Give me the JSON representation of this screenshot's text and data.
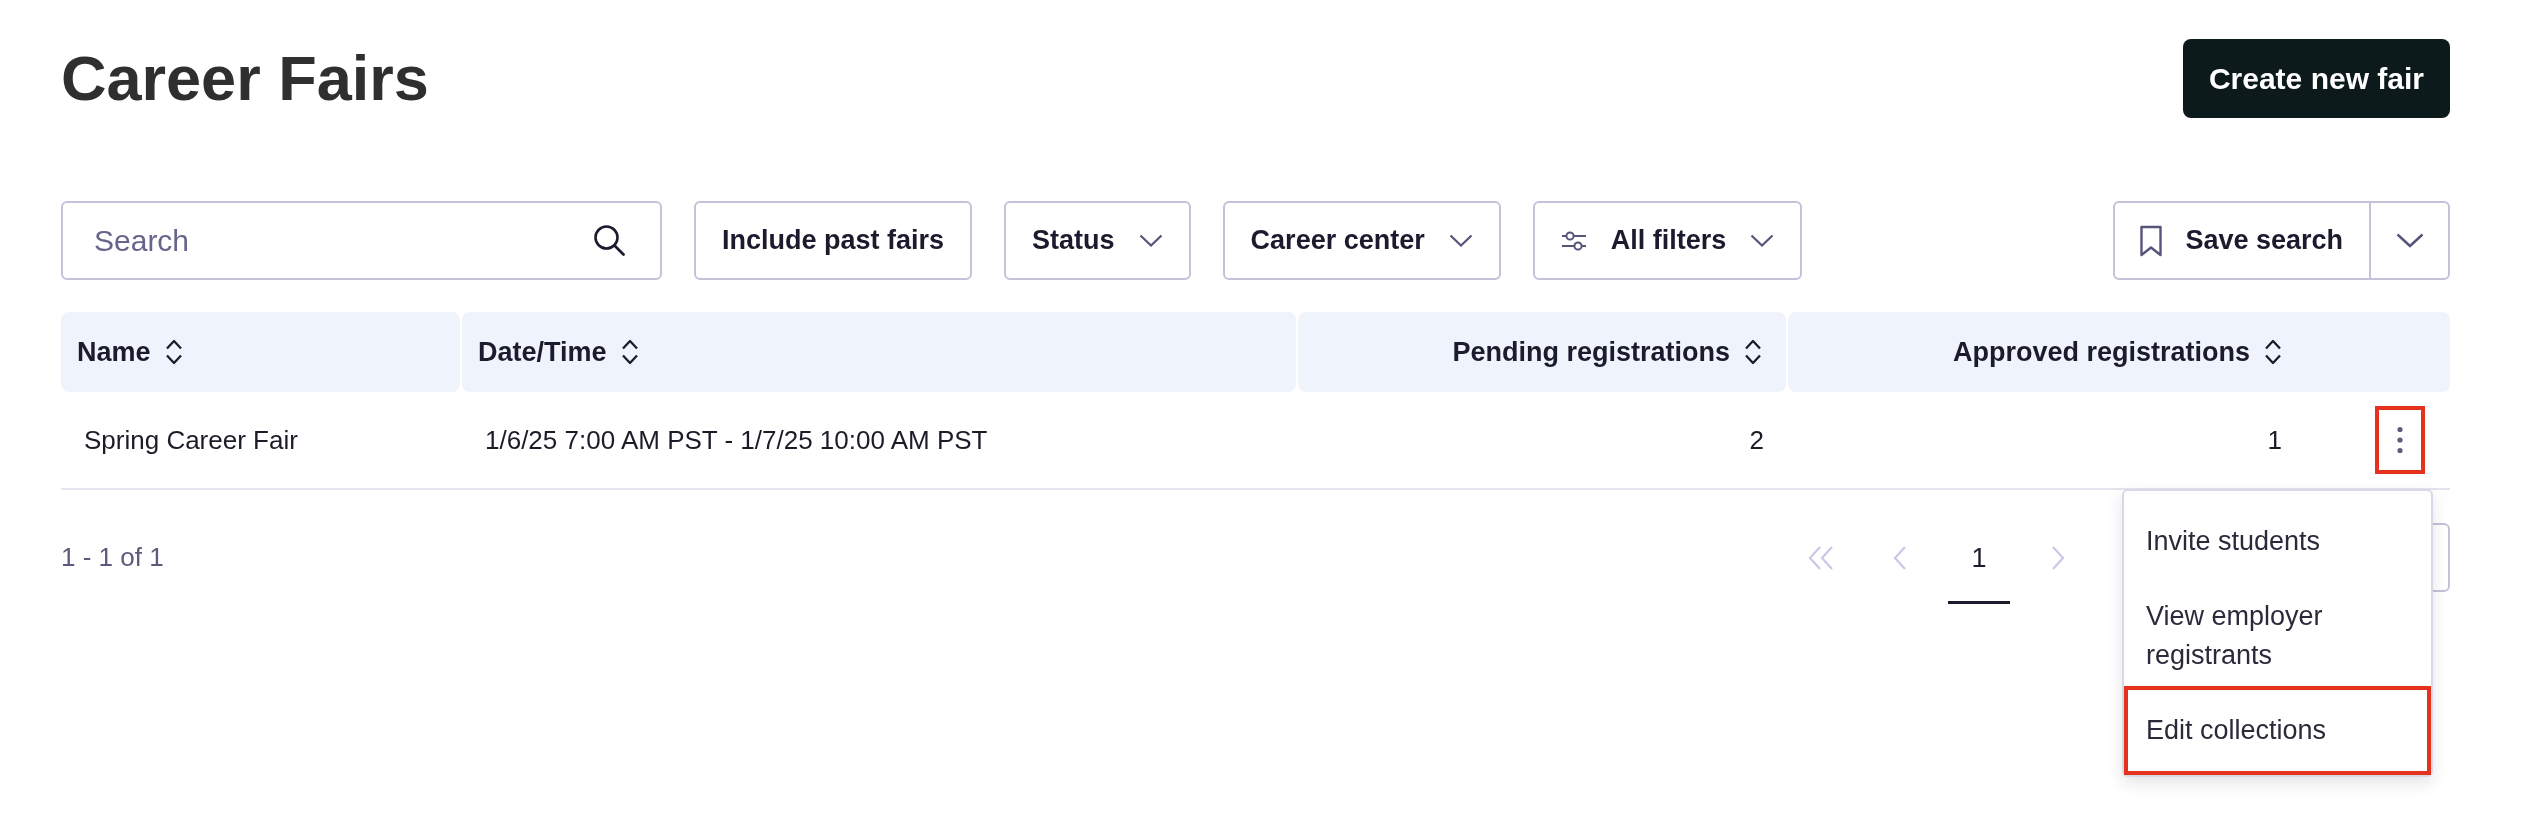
{
  "header": {
    "title": "Career Fairs",
    "create_button": "Create new fair"
  },
  "filters": {
    "search": {
      "placeholder": "Search"
    },
    "buttons": [
      {
        "kind": "toggle",
        "label": "Include past fairs"
      },
      {
        "kind": "dropdown",
        "label": "Status"
      },
      {
        "kind": "dropdown",
        "label": "Career center"
      },
      {
        "kind": "filters",
        "label": "All filters"
      }
    ],
    "save_search": "Save search"
  },
  "table": {
    "columns": [
      {
        "label": "Name",
        "kind": "text"
      },
      {
        "label": "Date/Time",
        "kind": "text"
      },
      {
        "label": "Pending registrations",
        "kind": "number"
      },
      {
        "label": "Approved registrations",
        "kind": "number"
      }
    ],
    "rows": [
      {
        "cells": [
          "Spring Career Fair",
          "1/6/25 7:00 AM PST - 1/7/25 10:00 AM PST",
          "2",
          "1"
        ],
        "more_button": {
          "highlighted": true
        }
      }
    ]
  },
  "row_menu": {
    "items": [
      {
        "label": "Invite students",
        "highlighted": false
      },
      {
        "label": "View employer registrants",
        "highlighted": false
      },
      {
        "label": "Edit collections",
        "highlighted": true
      }
    ]
  },
  "pagination": {
    "range": "1 - 1 of 1",
    "first": {
      "disabled": true
    },
    "previous": {
      "disabled": true
    },
    "pages": [
      {
        "label": "1",
        "selected": true
      }
    ],
    "next": {
      "disabled": true
    }
  }
}
